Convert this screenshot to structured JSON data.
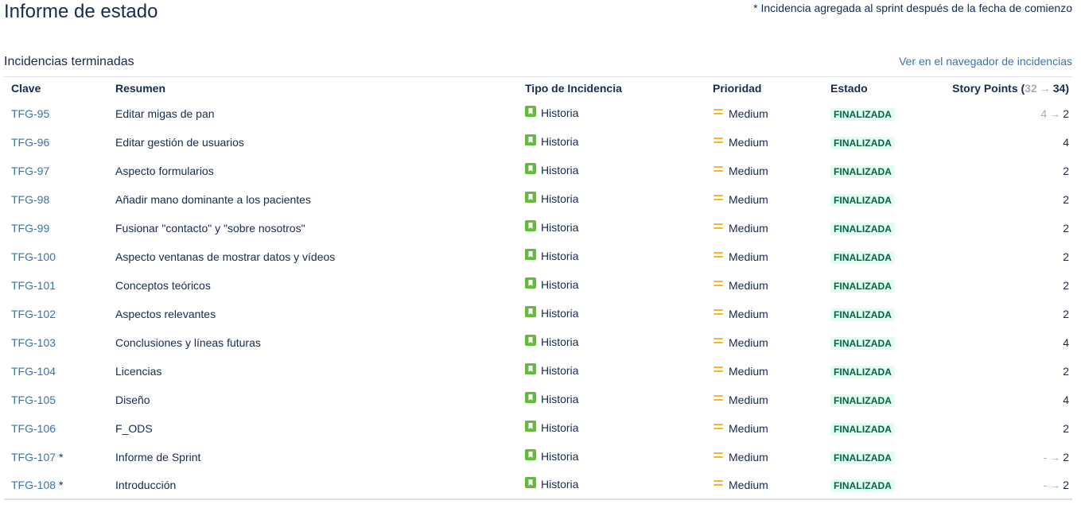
{
  "page": {
    "title": "Informe de estado",
    "note": "* Incidencia agregada al sprint después de la fecha de comienzo"
  },
  "section": {
    "title": "Incidencias terminadas",
    "navigator_link": "Ver en el navegador de incidencias"
  },
  "table": {
    "headers": {
      "key": "Clave",
      "summary": "Resumen",
      "type": "Tipo de Incidencia",
      "priority": "Prioridad",
      "status": "Estado",
      "story_points_label": "Story Points (",
      "story_points_old": "32",
      "story_points_arrow": "→",
      "story_points_new": "34",
      "story_points_close": ")"
    },
    "rows": [
      {
        "key": "TFG-95",
        "added": "",
        "summary": "Editar migas de pan",
        "type": "Historia",
        "priority": "Medium",
        "status": "FINALIZADA",
        "sp_old": "4",
        "sp_arrow": "→",
        "sp_new": "2"
      },
      {
        "key": "TFG-96",
        "added": "",
        "summary": "Editar gestión de usuarios",
        "type": "Historia",
        "priority": "Medium",
        "status": "FINALIZADA",
        "sp_old": "",
        "sp_arrow": "",
        "sp_new": "4"
      },
      {
        "key": "TFG-97",
        "added": "",
        "summary": "Aspecto formularios",
        "type": "Historia",
        "priority": "Medium",
        "status": "FINALIZADA",
        "sp_old": "",
        "sp_arrow": "",
        "sp_new": "2"
      },
      {
        "key": "TFG-98",
        "added": "",
        "summary": "Añadir mano dominante a los pacientes",
        "type": "Historia",
        "priority": "Medium",
        "status": "FINALIZADA",
        "sp_old": "",
        "sp_arrow": "",
        "sp_new": "2"
      },
      {
        "key": "TFG-99",
        "added": "",
        "summary": "Fusionar \"contacto\" y \"sobre nosotros\"",
        "type": "Historia",
        "priority": "Medium",
        "status": "FINALIZADA",
        "sp_old": "",
        "sp_arrow": "",
        "sp_new": "2"
      },
      {
        "key": "TFG-100",
        "added": "",
        "summary": "Aspecto ventanas de mostrar datos y vídeos",
        "type": "Historia",
        "priority": "Medium",
        "status": "FINALIZADA",
        "sp_old": "",
        "sp_arrow": "",
        "sp_new": "2"
      },
      {
        "key": "TFG-101",
        "added": "",
        "summary": "Conceptos teóricos",
        "type": "Historia",
        "priority": "Medium",
        "status": "FINALIZADA",
        "sp_old": "",
        "sp_arrow": "",
        "sp_new": "2"
      },
      {
        "key": "TFG-102",
        "added": "",
        "summary": "Aspectos relevantes",
        "type": "Historia",
        "priority": "Medium",
        "status": "FINALIZADA",
        "sp_old": "",
        "sp_arrow": "",
        "sp_new": "2"
      },
      {
        "key": "TFG-103",
        "added": "",
        "summary": "Conclusiones y líneas futuras",
        "type": "Historia",
        "priority": "Medium",
        "status": "FINALIZADA",
        "sp_old": "",
        "sp_arrow": "",
        "sp_new": "4"
      },
      {
        "key": "TFG-104",
        "added": "",
        "summary": "Licencias",
        "type": "Historia",
        "priority": "Medium",
        "status": "FINALIZADA",
        "sp_old": "",
        "sp_arrow": "",
        "sp_new": "2"
      },
      {
        "key": "TFG-105",
        "added": "",
        "summary": "Diseño",
        "type": "Historia",
        "priority": "Medium",
        "status": "FINALIZADA",
        "sp_old": "",
        "sp_arrow": "",
        "sp_new": "4"
      },
      {
        "key": "TFG-106",
        "added": "",
        "summary": "F_ODS",
        "type": "Historia",
        "priority": "Medium",
        "status": "FINALIZADA",
        "sp_old": "",
        "sp_arrow": "",
        "sp_new": "2"
      },
      {
        "key": "TFG-107",
        "added": "*",
        "summary": "Informe de Sprint",
        "type": "Historia",
        "priority": "Medium",
        "status": "FINALIZADA",
        "sp_old": "-",
        "sp_arrow": "→",
        "sp_new": "2"
      },
      {
        "key": "TFG-108",
        "added": "*",
        "summary": "Introducción",
        "type": "Historia",
        "priority": "Medium",
        "status": "FINALIZADA",
        "sp_old": "-",
        "sp_arrow": "→",
        "sp_new": "2"
      }
    ]
  },
  "icons": {
    "type_icon": "story-bookmark-icon",
    "priority_icon": "priority-medium-icon"
  },
  "colors": {
    "link": "#3b73af",
    "story_icon": "#63ba3c",
    "priority_medium": "#f4b62c",
    "status_bg": "#e3fcef",
    "status_text": "#006644",
    "muted": "#a5adba",
    "text": "#172b4d"
  }
}
